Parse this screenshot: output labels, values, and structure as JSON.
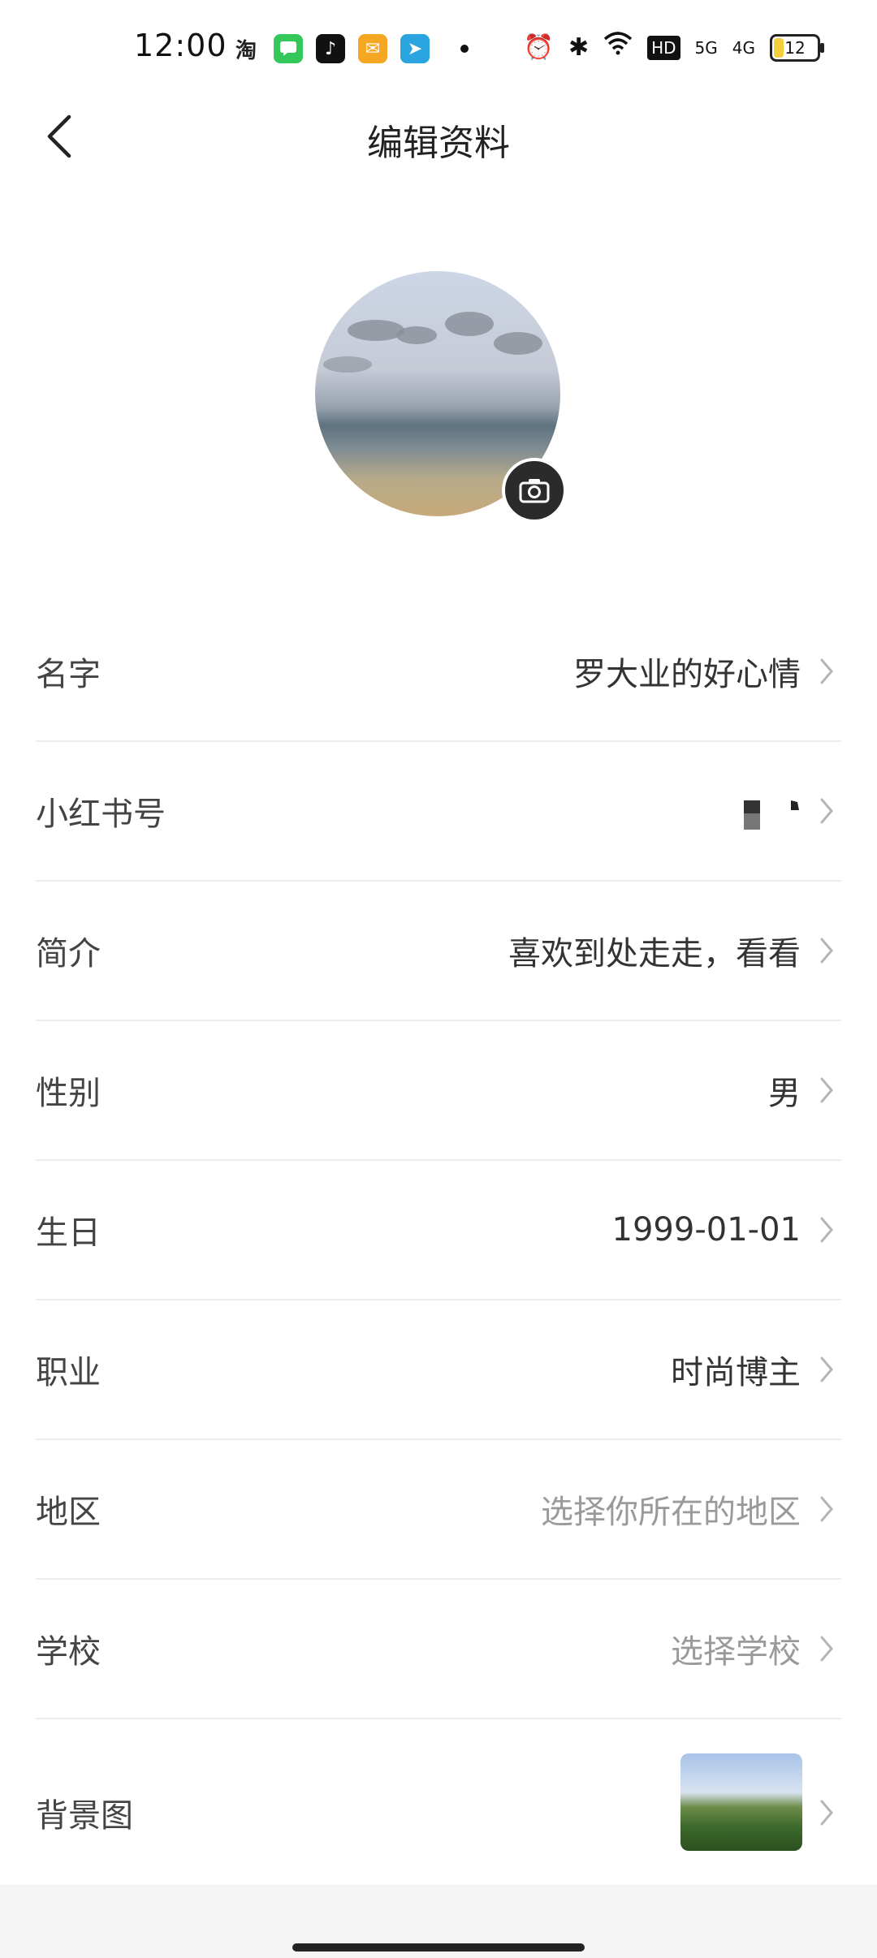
{
  "status_bar": {
    "time": "12:00",
    "apps": [
      {
        "icon": "taobao-icon",
        "text": "淘",
        "color": "#ffffff",
        "fg": "#222222"
      },
      {
        "icon": "messages-icon",
        "text": "",
        "color": "#34c759"
      },
      {
        "icon": "tiktok-icon",
        "text": "♪",
        "color": "#111111"
      },
      {
        "icon": "mail-icon",
        "text": "✉",
        "color": "#f5a623"
      },
      {
        "icon": "telegram-icon",
        "text": "➤",
        "color": "#2aa5e0"
      }
    ],
    "network": {
      "hd": "HD",
      "g5": "5G",
      "g4": "4G"
    },
    "battery": "12"
  },
  "header": {
    "title": "编辑资料"
  },
  "profile": {
    "rows": [
      {
        "label": "名字",
        "value": "罗大业的好心情",
        "placeholder": false
      },
      {
        "label": "小红书号",
        "value": "",
        "redacted": true
      },
      {
        "label": "简介",
        "value": "喜欢到处走走，看看",
        "placeholder": false
      },
      {
        "label": "性别",
        "value": "男",
        "placeholder": false
      },
      {
        "label": "生日",
        "value": "1999-01-01",
        "placeholder": false
      },
      {
        "label": "职业",
        "value": "时尚博主",
        "placeholder": false
      },
      {
        "label": "地区",
        "value": "选择你所在的地区",
        "placeholder": true
      },
      {
        "label": "学校",
        "value": "选择学校",
        "placeholder": true
      },
      {
        "label": "背景图",
        "value": "",
        "thumbnail": true
      }
    ]
  },
  "colors": {
    "placeholder": "#9a9a9a",
    "divider": "#ececec",
    "camera_badge": "#2b2b2b"
  }
}
